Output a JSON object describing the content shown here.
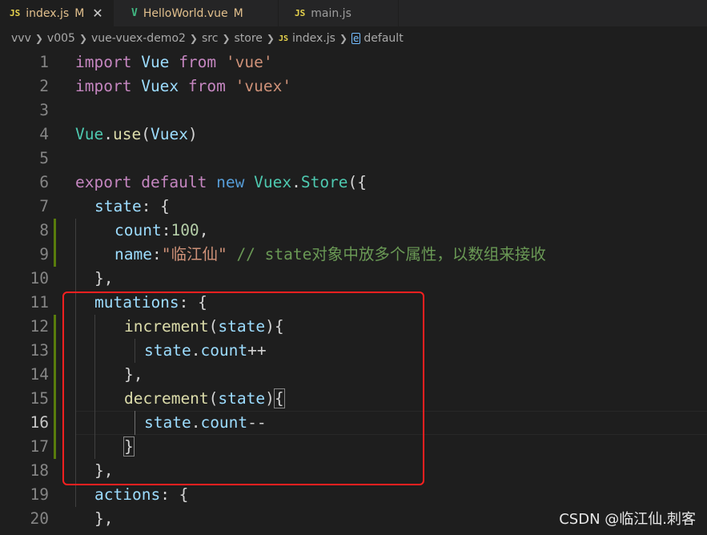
{
  "tabs": [
    {
      "icon": "JS",
      "label": "index.js",
      "status": "M",
      "close": "✕",
      "active": true
    },
    {
      "icon": "V",
      "label": "HelloWorld.vue",
      "status": "M",
      "active": false
    },
    {
      "icon": "JS",
      "label": "main.js",
      "active": false
    }
  ],
  "breadcrumb": {
    "items": [
      "vvv",
      "v005",
      "vue-vuex-demo2",
      "src",
      "store"
    ],
    "file_icon": "JS",
    "file": "index.js",
    "symbol": "default"
  },
  "editor": {
    "active_line": 16,
    "lines": [
      {
        "n": "1"
      },
      {
        "n": "2"
      },
      {
        "n": "3"
      },
      {
        "n": "4"
      },
      {
        "n": "5"
      },
      {
        "n": "6"
      },
      {
        "n": "7"
      },
      {
        "n": "8"
      },
      {
        "n": "9"
      },
      {
        "n": "10"
      },
      {
        "n": "11"
      },
      {
        "n": "12"
      },
      {
        "n": "13"
      },
      {
        "n": "14"
      },
      {
        "n": "15"
      },
      {
        "n": "16"
      },
      {
        "n": "17"
      },
      {
        "n": "18"
      },
      {
        "n": "19"
      },
      {
        "n": "20"
      }
    ],
    "code": {
      "l1": {
        "k": "import",
        "a": "Vue",
        "f": "from",
        "s": "'vue'"
      },
      "l2": {
        "k": "import",
        "a": "Vuex",
        "f": "from",
        "s": "'vuex'"
      },
      "l4": {
        "a": "Vue",
        "d": ".",
        "m": "use",
        "o": "(",
        "b": "Vuex",
        "c": ")"
      },
      "l6": {
        "k1": "export",
        "k2": "default",
        "k3": "new",
        "a": "Vuex",
        "d": ".",
        "m": "Store",
        "o": "({"
      },
      "l7": {
        "p": "state",
        "r": ": {"
      },
      "l8": {
        "p": "count",
        "c": ":",
        "v": "100",
        "e": ","
      },
      "l9": {
        "p": "name",
        "c": ":",
        "s": "\"临江仙\"",
        "cm": " // state对象中放多个属性，以数组来接收"
      },
      "l10": {
        "t": "},"
      },
      "l11": {
        "p": "mutations",
        "r": ": {"
      },
      "l12": {
        "m": "increment",
        "o": "(",
        "a": "state",
        "c": ")",
        "b": "{"
      },
      "l13": {
        "a": "state",
        "d": ".",
        "p": "count",
        "op": "++"
      },
      "l14": {
        "t": "},"
      },
      "l15": {
        "m": "decrement",
        "o": "(",
        "a": "state",
        "c": ")",
        "b": "{"
      },
      "l16": {
        "a": "state",
        "d": ".",
        "p": "count",
        "op": "--"
      },
      "l17": {
        "b": "}"
      },
      "l18": {
        "t": "},"
      },
      "l19": {
        "p": "actions",
        "r": ": {"
      },
      "l20": {
        "t": "},"
      }
    }
  },
  "watermark": "CSDN @临江仙.刺客",
  "colors": {
    "highlight_box": "#ff2020",
    "background": "#1e1e1e",
    "gutter_modified": "#587c0c"
  }
}
